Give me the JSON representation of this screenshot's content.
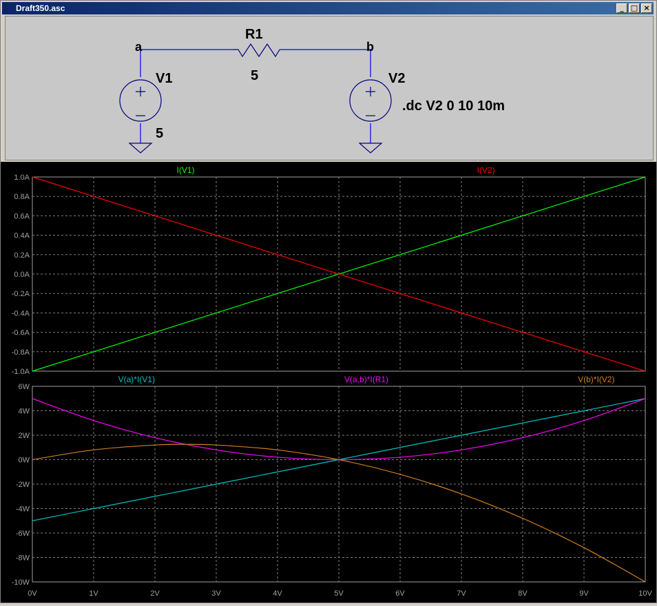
{
  "window": {
    "title": "Draft350.asc"
  },
  "titlebar_buttons": [
    "_",
    "□",
    "×"
  ],
  "schematic": {
    "node_a": "a",
    "node_b": "b",
    "r1_name": "R1",
    "r1_value": "5",
    "v1_name": "V1",
    "v1_value": "5",
    "v2_name": "V2",
    "directive": ".dc V2 0 10 10m",
    "colors": {
      "wire": "#0000ff",
      "component": "#000080"
    }
  },
  "chart_data": [
    {
      "type": "line",
      "title": "",
      "xlim": [
        0,
        10
      ],
      "ylim": [
        -1.0,
        1.0
      ],
      "x_ticks": [
        "0V",
        "1V",
        "2V",
        "3V",
        "4V",
        "5V",
        "6V",
        "7V",
        "8V",
        "9V",
        "10V"
      ],
      "y_ticks": [
        "1.0A",
        "0.8A",
        "0.6A",
        "0.4A",
        "0.2A",
        "0.0A",
        "-0.2A",
        "-0.4A",
        "-0.6A",
        "-0.8A",
        "-1.0A"
      ],
      "grid": true,
      "series": [
        {
          "name": "I(V1)",
          "color": "#00ff00",
          "x": [
            0,
            10
          ],
          "y": [
            -1.0,
            1.0
          ]
        },
        {
          "name": "I(V2)",
          "color": "#ff0000",
          "x": [
            0,
            10
          ],
          "y": [
            1.0,
            -1.0
          ]
        }
      ]
    },
    {
      "type": "line",
      "title": "",
      "xlim": [
        0,
        10
      ],
      "ylim": [
        -10,
        6
      ],
      "x_ticks": [
        "0V",
        "1V",
        "2V",
        "3V",
        "4V",
        "5V",
        "6V",
        "7V",
        "8V",
        "9V",
        "10V"
      ],
      "y_ticks": [
        "6W",
        "4W",
        "2W",
        "0W",
        "-2W",
        "-4W",
        "-6W",
        "-8W",
        "-10W"
      ],
      "grid": true,
      "series": [
        {
          "name": "V(a)*I(V1)",
          "color": "#00c0c0",
          "x": [
            0,
            1,
            2,
            3,
            4,
            5,
            6,
            7,
            8,
            9,
            10
          ],
          "y": [
            -5,
            -4,
            -3,
            -2,
            -1,
            0,
            1,
            2,
            3,
            4,
            5
          ]
        },
        {
          "name": "V(a,b)*I(R1)",
          "color": "#ff00ff",
          "x": [
            0,
            1,
            2,
            3,
            4,
            5,
            6,
            7,
            8,
            9,
            10
          ],
          "y": [
            5,
            3.2,
            1.8,
            0.8,
            0.2,
            0,
            0.2,
            0.8,
            1.8,
            3.2,
            5
          ]
        },
        {
          "name": "V(b)*I(V2)",
          "color": "#d08020",
          "x": [
            0,
            1,
            2,
            2.5,
            3,
            4,
            5,
            6,
            7,
            8,
            9,
            10
          ],
          "y": [
            0,
            0.8,
            1.2,
            1.25,
            1.2,
            0.8,
            0,
            -1.2,
            -2.8,
            -4.8,
            -7.2,
            -10
          ]
        }
      ]
    }
  ]
}
